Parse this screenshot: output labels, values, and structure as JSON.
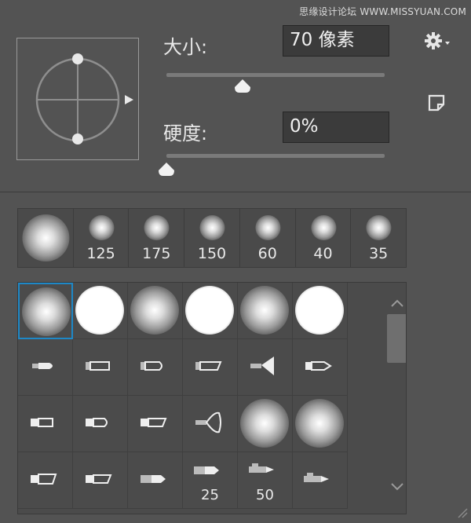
{
  "watermark": "思缘设计论坛 WWW.MISSYUAN.COM",
  "size": {
    "label": "大小:",
    "value": "70 像素",
    "slider_pct": 0.35
  },
  "hardness": {
    "label": "硬度:",
    "value": "0%",
    "slider_pct": 0.0
  },
  "icons": {
    "gear": "gear-icon",
    "new_preset": "new-preset-icon",
    "scroll_up": "chevron-up-icon",
    "scroll_down": "chevron-down-icon",
    "resize": "resize-grip-icon"
  },
  "recent_brushes": [
    {
      "number": ""
    },
    {
      "number": "125"
    },
    {
      "number": "175"
    },
    {
      "number": "150"
    },
    {
      "number": "60"
    },
    {
      "number": "40"
    },
    {
      "number": "35"
    }
  ],
  "brush_grid": [
    [
      {
        "type": "soft",
        "number": ""
      },
      {
        "type": "hard",
        "number": ""
      },
      {
        "type": "soft",
        "number": ""
      },
      {
        "type": "hard",
        "number": ""
      },
      {
        "type": "soft",
        "number": ""
      },
      {
        "type": "hard",
        "number": ""
      }
    ],
    [
      {
        "type": "tip-a",
        "number": ""
      },
      {
        "type": "tip-b",
        "number": ""
      },
      {
        "type": "tip-c",
        "number": ""
      },
      {
        "type": "tip-d",
        "number": ""
      },
      {
        "type": "tip-fan",
        "number": ""
      },
      {
        "type": "tip-point",
        "number": ""
      }
    ],
    [
      {
        "type": "tip-flat",
        "number": ""
      },
      {
        "type": "tip-round",
        "number": ""
      },
      {
        "type": "tip-angle",
        "number": ""
      },
      {
        "type": "tip-fan2",
        "number": ""
      },
      {
        "type": "soft-large",
        "number": ""
      },
      {
        "type": "soft-large",
        "number": ""
      }
    ],
    [
      {
        "type": "tip-angle2",
        "number": ""
      },
      {
        "type": "tip-angle3",
        "number": ""
      },
      {
        "type": "tip-marker",
        "number": ""
      },
      {
        "type": "tip-pencil",
        "number": "25"
      },
      {
        "type": "tip-pencil2",
        "number": "50"
      },
      {
        "type": "tip-pencil3",
        "number": ""
      }
    ]
  ],
  "colors": {
    "accent": "#1e88c7",
    "panel": "#535353",
    "field": "#3b3b3b"
  }
}
